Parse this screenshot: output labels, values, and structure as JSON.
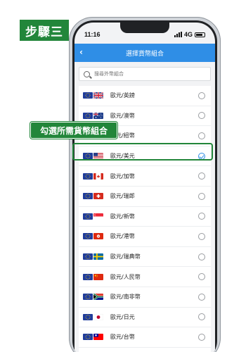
{
  "step_badge": "步驟三",
  "callout": "勾選所需貨幣組合",
  "status_bar": {
    "time": "11:16",
    "network": "4G"
  },
  "nav": {
    "title": "選擇貨幣組合"
  },
  "search": {
    "placeholder": "搜尋外幣組合"
  },
  "pairs": [
    {
      "label": "歐元/英鎊",
      "flag2": "uk",
      "checked": false
    },
    {
      "label": "歐元/澳幣",
      "flag2": "au",
      "checked": false
    },
    {
      "label": "歐元/紐幣",
      "flag2": "nz",
      "checked": false
    },
    {
      "label": "歐元/美元",
      "flag2": "us",
      "checked": true
    },
    {
      "label": "歐元/加幣",
      "flag2": "ca",
      "checked": false
    },
    {
      "label": "歐元/瑞郎",
      "flag2": "ch",
      "checked": false
    },
    {
      "label": "歐元/新幣",
      "flag2": "sg",
      "checked": false
    },
    {
      "label": "歐元/港幣",
      "flag2": "hk",
      "checked": false
    },
    {
      "label": "歐元/瑞典幣",
      "flag2": "se",
      "checked": false
    },
    {
      "label": "歐元/人民幣",
      "flag2": "cn",
      "checked": false
    },
    {
      "label": "歐元/南非幣",
      "flag2": "za",
      "checked": false
    },
    {
      "label": "歐元/日元",
      "flag2": "jp",
      "checked": false
    },
    {
      "label": "歐元/台幣",
      "flag2": "tw",
      "checked": false
    }
  ],
  "colors": {
    "accent_green": "#22863a",
    "nav_blue": "#2f8ee6"
  }
}
